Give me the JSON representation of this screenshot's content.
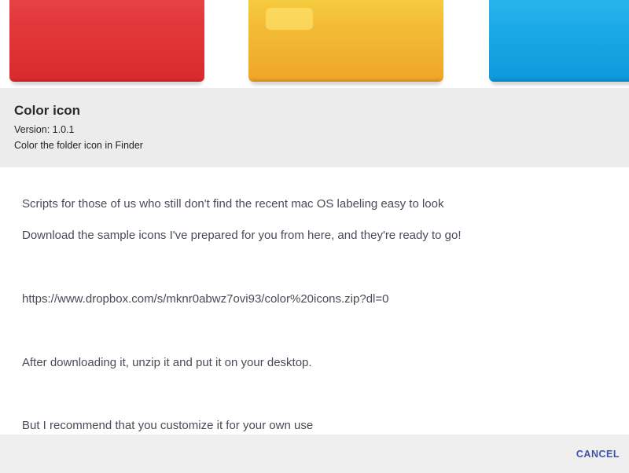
{
  "banner": {
    "folders": [
      {
        "icon": "red-folder-icon",
        "color": "#e2383c"
      },
      {
        "icon": "yellow-folder-icon",
        "color": "#f3bb35"
      },
      {
        "icon": "blue-folder-icon",
        "color": "#1aa9e6"
      }
    ]
  },
  "header": {
    "title": "Color icon",
    "version": "Version: 1.0.1",
    "tagline": "Color the folder icon in Finder"
  },
  "description": {
    "line1": "Scripts for those of us who still don't find the recent mac OS labeling easy to look",
    "line2": "Download the sample icons I've prepared for you from here, and they're ready to go!",
    "link": "https://www.dropbox.com/s/mknr0abwz7ovi93/color%20icons.zip?dl=0",
    "line3": "After downloading it, unzip it and put it on your desktop.",
    "line4": "But I recommend that you customize it for your own use"
  },
  "footer": {
    "cancel_label": "CANCEL",
    "accent_color": "#3f51b5"
  }
}
